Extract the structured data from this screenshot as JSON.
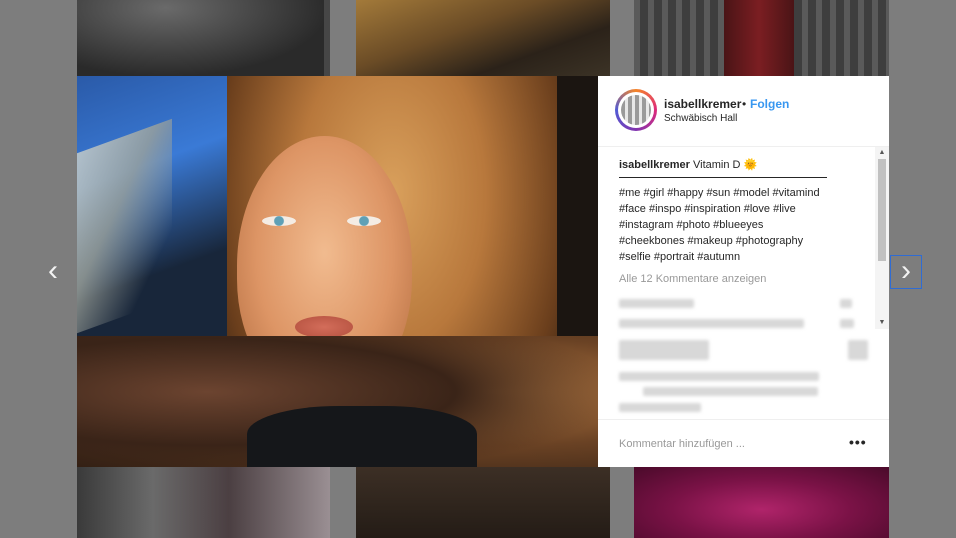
{
  "post": {
    "username": "isabellkremer",
    "separator_dot": "•",
    "follow_label": "Folgen",
    "location": "Schwäbisch Hall"
  },
  "caption": {
    "username": "isabellkremer",
    "text": "Vitamin D",
    "emoji": "🌞",
    "separator_line": "________________________________",
    "hashtag_lines": [
      "#me #girl #happy #sun #model #vitamind",
      "#face #inspo #inspiration #love #live",
      "#instagram #photo #blueeyes",
      "#cheekbones #makeup #photography",
      "#selfie #portrait #autumn"
    ]
  },
  "comments": {
    "view_all_label": "Alle 12 Kommentare anzeigen"
  },
  "composer": {
    "placeholder": "Kommentar hinzufügen ...",
    "more_label": "•••"
  },
  "nav": {
    "prev_label": "‹",
    "next_label": "›"
  },
  "scrollbar": {
    "up_label": "▲",
    "down_label": "▼"
  },
  "colors": {
    "link_blue": "#3897f0",
    "text_dark": "#262626",
    "text_muted": "#999999",
    "overlay_gray": "#7d7d7d"
  }
}
